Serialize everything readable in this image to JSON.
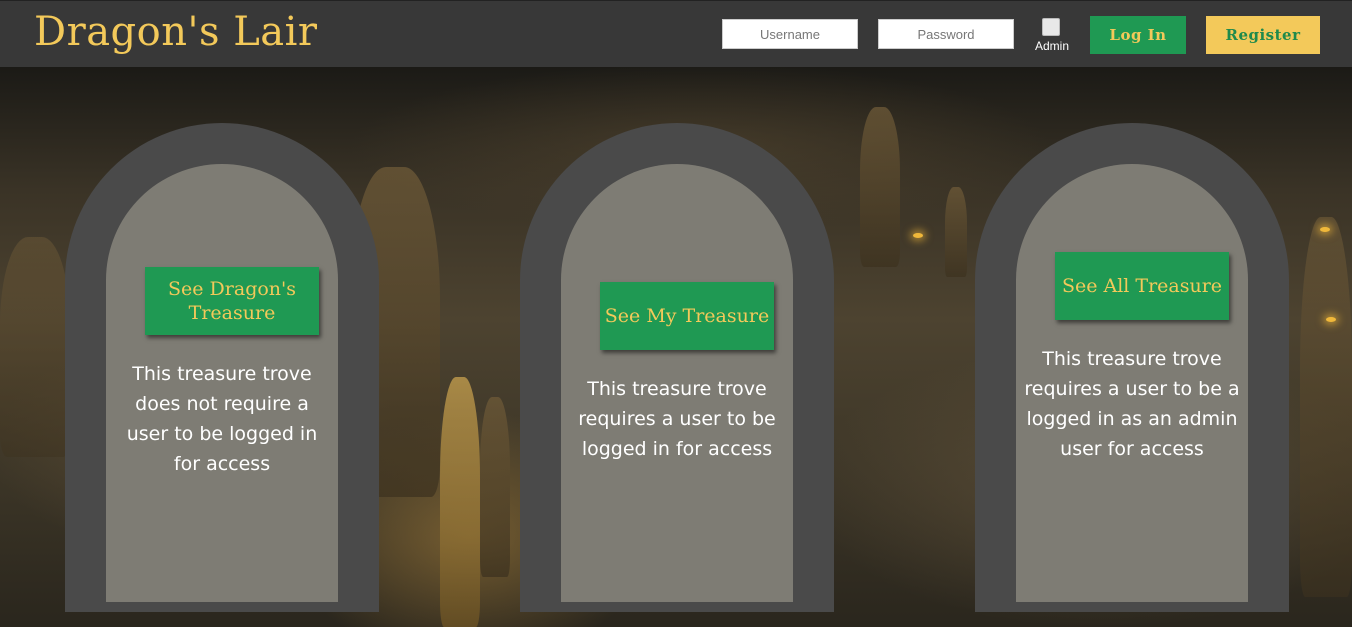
{
  "header": {
    "brand": "Dragon's Lair",
    "username_placeholder": "Username",
    "password_placeholder": "Password",
    "admin_label": "Admin",
    "login_label": "Log In",
    "register_label": "Register"
  },
  "cards": [
    {
      "button_label": "See Dragon's Treasure",
      "description": "This treasure trove does not require a user to be logged in for access"
    },
    {
      "button_label": "See My Treasure",
      "description": "This treasure trove requires a user to be logged in for access"
    },
    {
      "button_label": "See All Treasure",
      "description": "This treasure trove requires a user to be a logged in as an admin user for access"
    }
  ],
  "colors": {
    "header_bg": "#383838",
    "brand_gold": "#f3c95a",
    "button_green": "#1f9953",
    "arch_gray": "#4a4a4a"
  }
}
